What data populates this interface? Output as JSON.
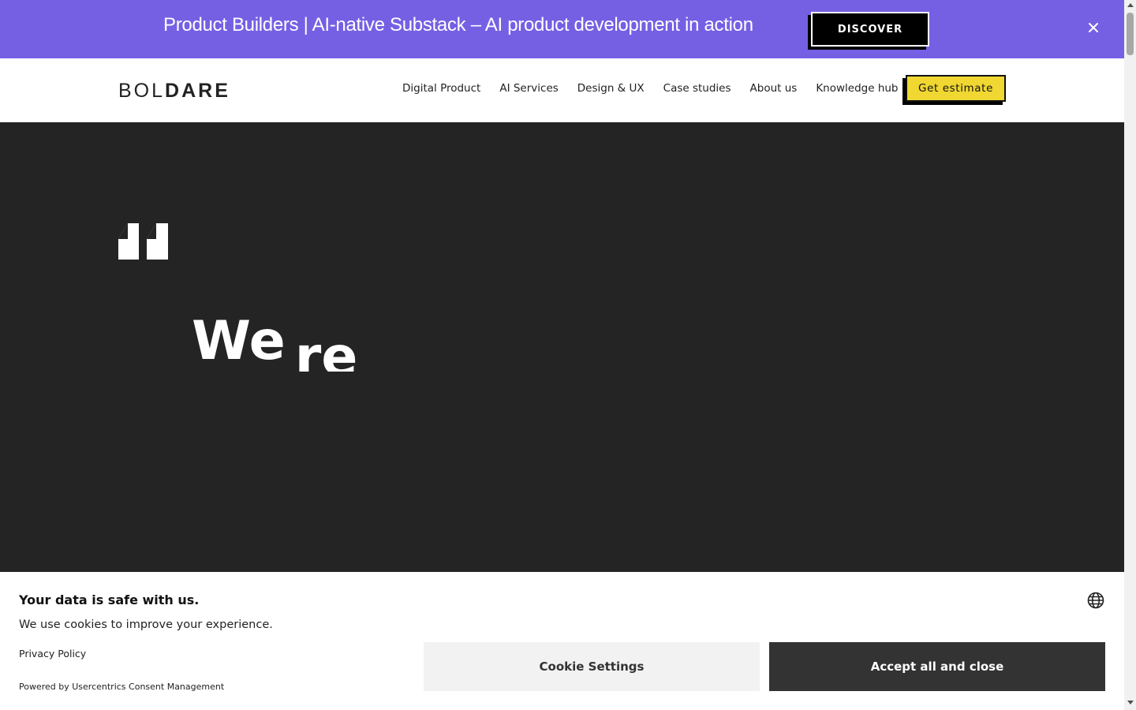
{
  "promo": {
    "text": "Product Builders | AI-native Substack – AI product development in action",
    "button_label": "DISCOVER",
    "close_icon": "close-icon",
    "background": "#7560e4"
  },
  "header": {
    "logo_light": "BOL",
    "logo_bold": "DARE",
    "nav": [
      {
        "label": "Digital Product"
      },
      {
        "label": "AI Services"
      },
      {
        "label": "Design & UX"
      },
      {
        "label": "Case studies"
      },
      {
        "label": "About us"
      },
      {
        "label": "Knowledge hub"
      }
    ],
    "cta_label": "Get estimate",
    "cta_color": "#f0d732"
  },
  "hero": {
    "icon": "quote-icon",
    "text_word1": "We",
    "text_word2": "re",
    "background": "#242424"
  },
  "cookie": {
    "title": "Your data is safe with us.",
    "description": "We use cookies to improve your experience.",
    "privacy_link": "Privacy Policy",
    "powered_by": "Powered by Usercentrics Consent Management",
    "language_icon": "globe-icon",
    "settings_label": "Cookie Settings",
    "accept_label": "Accept all and close"
  }
}
